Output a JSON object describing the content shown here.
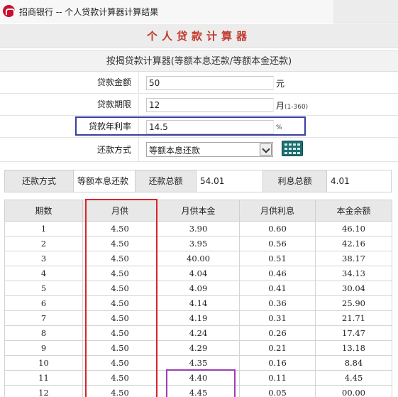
{
  "window": {
    "title": "招商银行 -- 个人贷款计算器计算结果"
  },
  "page": {
    "title": "个人贷款计算器"
  },
  "calculator": {
    "heading": "按揭贷款计算器(等额本息还款/等额本金还款)",
    "fields": [
      {
        "label": "贷款金额",
        "value": "50",
        "unit": "元",
        "unit_note": ""
      },
      {
        "label": "贷款期限",
        "value": "12",
        "unit": "月",
        "unit_note": "(1-360)"
      },
      {
        "label": "贷款年利率",
        "value": "14.5",
        "unit": "%",
        "unit_note": ""
      }
    ],
    "method": {
      "label": "还款方式",
      "value": "等额本息还款"
    }
  },
  "summary": {
    "method_label": "还款方式",
    "method_value": "等额本息还款",
    "total_label": "还款总额",
    "total_value": "54.01",
    "interest_label": "利息总额",
    "interest_value": "4.01"
  },
  "table": {
    "headers": [
      "期数",
      "月供",
      "月供本金",
      "月供利息",
      "本金余额"
    ],
    "rows": [
      [
        "1",
        "4.50",
        "3.90",
        "0.60",
        "46.10"
      ],
      [
        "2",
        "4.50",
        "3.95",
        "0.56",
        "42.16"
      ],
      [
        "3",
        "4.50",
        "40.00",
        "0.51",
        "38.17"
      ],
      [
        "4",
        "4.50",
        "4.04",
        "0.46",
        "34.13"
      ],
      [
        "5",
        "4.50",
        "4.09",
        "0.41",
        "30.04"
      ],
      [
        "6",
        "4.50",
        "4.14",
        "0.36",
        "25.90"
      ],
      [
        "7",
        "4.50",
        "4.19",
        "0.31",
        "21.71"
      ],
      [
        "8",
        "4.50",
        "4.24",
        "0.26",
        "17.47"
      ],
      [
        "9",
        "4.50",
        "4.29",
        "0.21",
        "13.18"
      ],
      [
        "10",
        "4.50",
        "4.35",
        "0.16",
        "8.84"
      ],
      [
        "11",
        "4.50",
        "4.40",
        "0.11",
        "4.45"
      ],
      [
        "12",
        "4.50",
        "4.45",
        "0.05",
        "00.00"
      ]
    ]
  },
  "colors": {
    "title_red": "#c0392b",
    "highlight_red": "#d9232a",
    "highlight_blue": "#3a3fa0",
    "highlight_purple": "#9b3fb3",
    "header_gray": "#e8e8e8"
  }
}
